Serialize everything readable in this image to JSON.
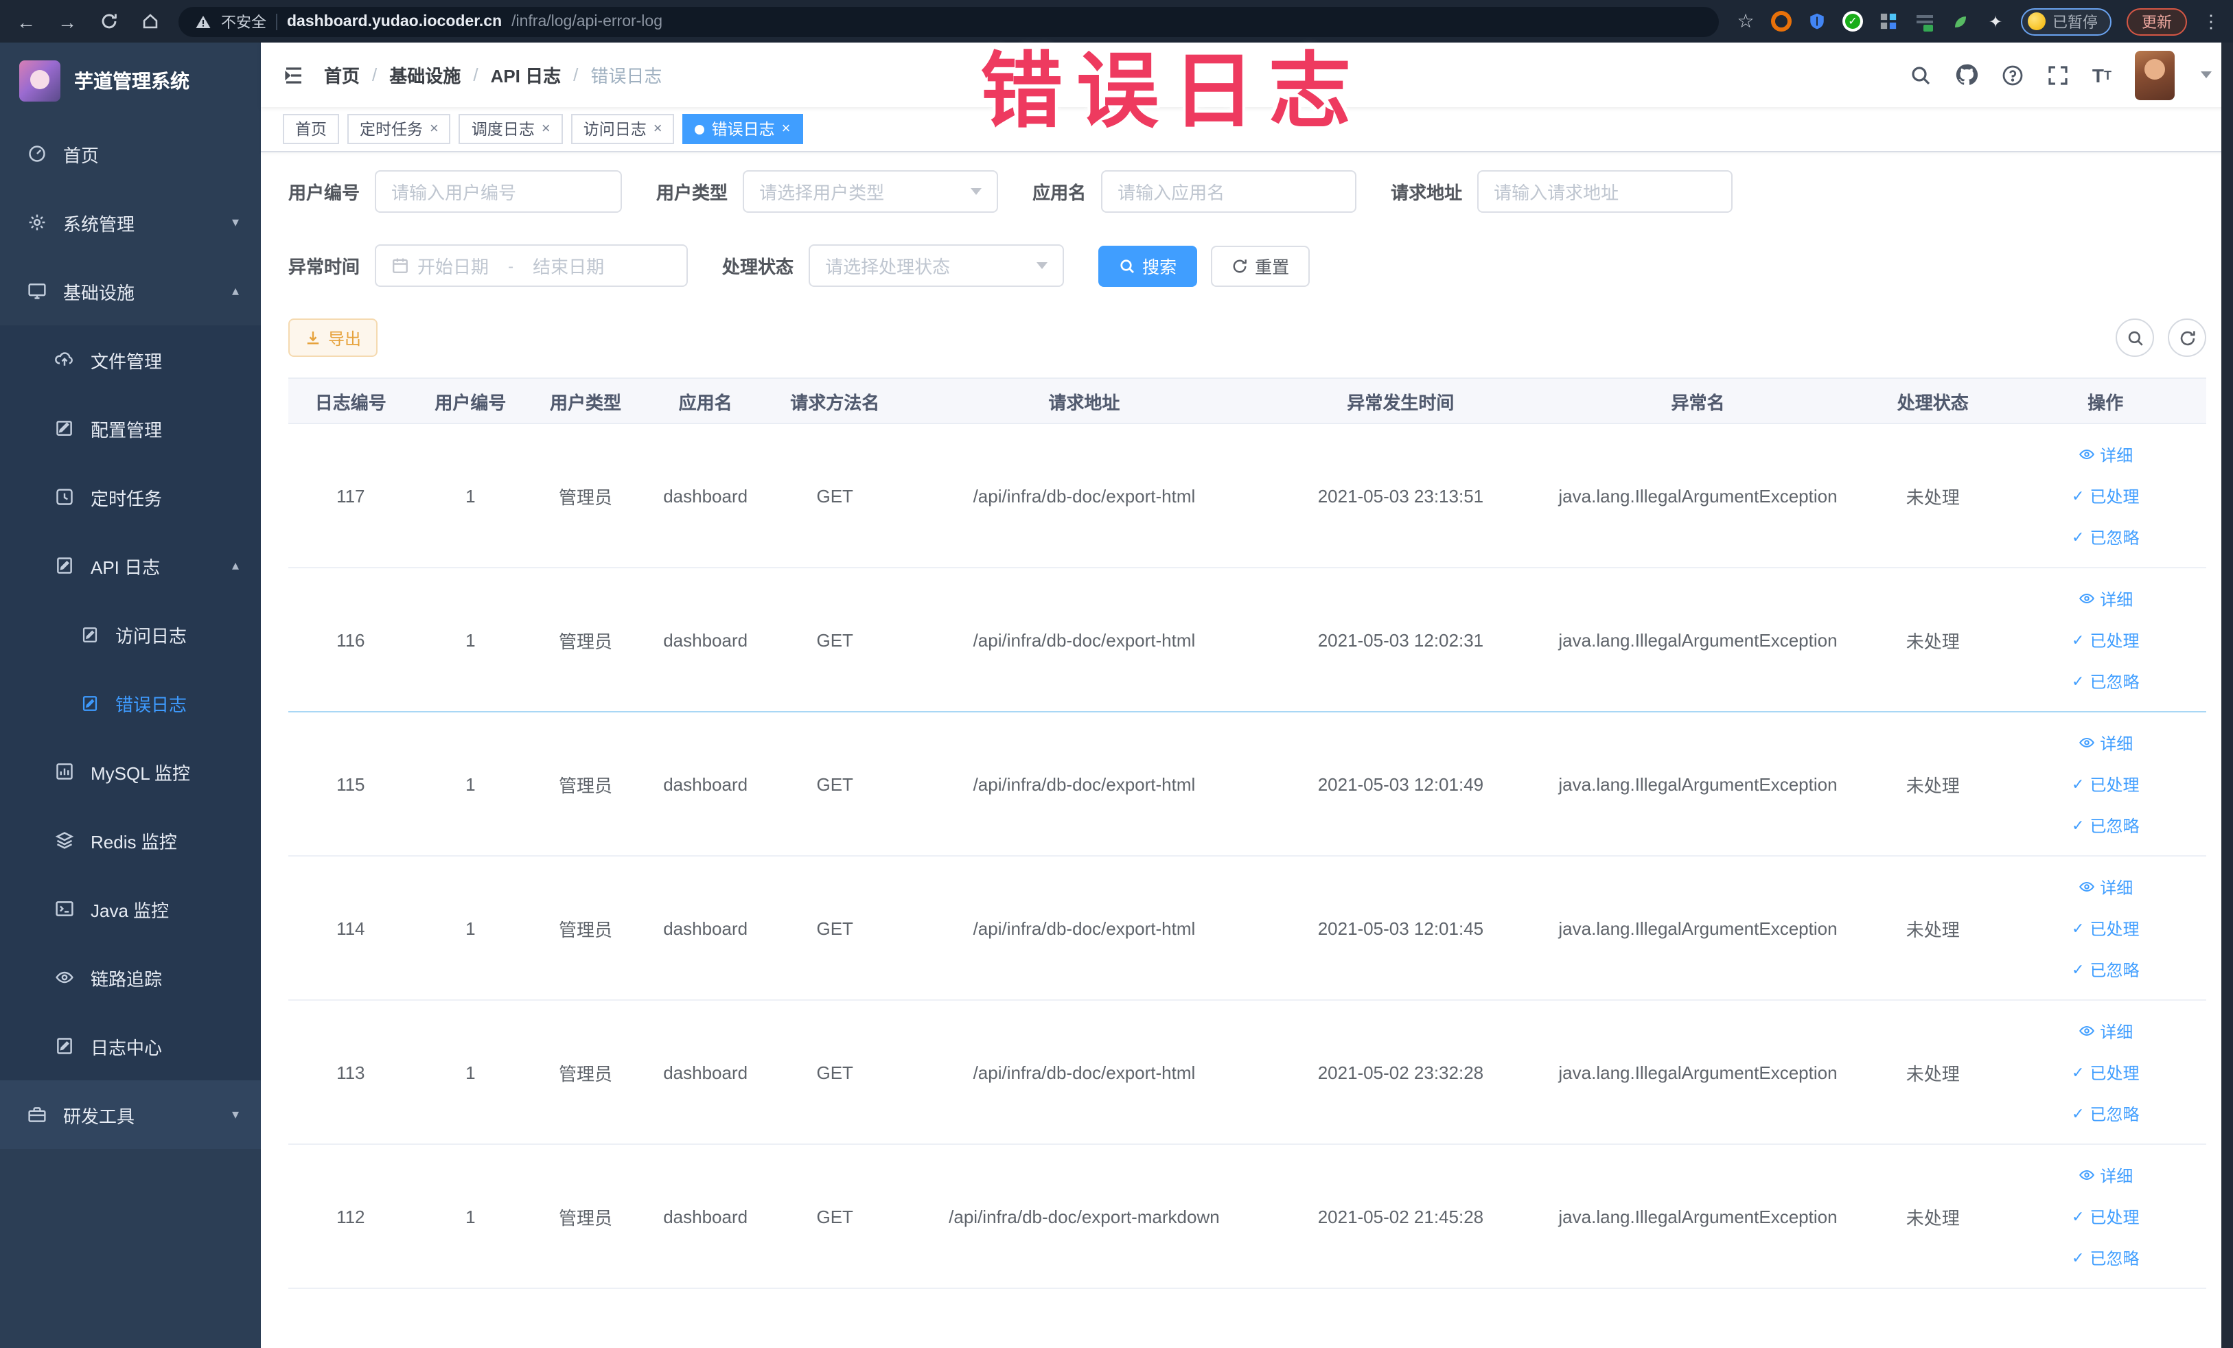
{
  "browser": {
    "security_label": "不安全",
    "url_domain": "dashboard.yudao.iocoder.cn",
    "url_path": "/infra/log/api-error-log",
    "paused_badge": "已暂停",
    "update_label": "更新"
  },
  "annotation_text": "错误日志",
  "sidebar": {
    "title": "芋道管理系统",
    "items": [
      {
        "label": "首页"
      },
      {
        "label": "系统管理"
      },
      {
        "label": "基础设施"
      },
      {
        "label": "文件管理"
      },
      {
        "label": "配置管理"
      },
      {
        "label": "定时任务"
      },
      {
        "label": "API 日志"
      },
      {
        "label": "访问日志"
      },
      {
        "label": "错误日志"
      },
      {
        "label": "MySQL 监控"
      },
      {
        "label": "Redis 监控"
      },
      {
        "label": "Java 监控"
      },
      {
        "label": "链路追踪"
      },
      {
        "label": "日志中心"
      },
      {
        "label": "研发工具"
      }
    ]
  },
  "breadcrumb": {
    "items": [
      "首页",
      "基础设施",
      "API 日志",
      "错误日志"
    ]
  },
  "tags": [
    {
      "label": "首页"
    },
    {
      "label": "定时任务"
    },
    {
      "label": "调度日志"
    },
    {
      "label": "访问日志"
    },
    {
      "label": "错误日志"
    }
  ],
  "filters": {
    "user_id_label": "用户编号",
    "user_id_placeholder": "请输入用户编号",
    "user_type_label": "用户类型",
    "user_type_placeholder": "请选择用户类型",
    "app_name_label": "应用名",
    "app_name_placeholder": "请输入应用名",
    "request_url_label": "请求地址",
    "request_url_placeholder": "请输入请求地址",
    "exception_time_label": "异常时间",
    "date_start_placeholder": "开始日期",
    "date_separator": "-",
    "date_end_placeholder": "结束日期",
    "process_status_label": "处理状态",
    "process_status_placeholder": "请选择处理状态",
    "search_label": "搜索",
    "reset_label": "重置"
  },
  "toolbar": {
    "export_label": "导出"
  },
  "table": {
    "headers": [
      "日志编号",
      "用户编号",
      "用户类型",
      "应用名",
      "请求方法名",
      "请求地址",
      "异常发生时间",
      "异常名",
      "处理状态",
      "操作"
    ],
    "action_labels": {
      "detail": "详细",
      "processed": "已处理",
      "ignored": "已忽略"
    },
    "rows": [
      {
        "cells": [
          "117",
          "1",
          "管理员",
          "dashboard",
          "GET",
          "/api/infra/db-doc/export-html",
          "2021-05-03 23:13:51",
          "java.lang.IllegalArgumentException",
          "未处理"
        ]
      },
      {
        "cells": [
          "116",
          "1",
          "管理员",
          "dashboard",
          "GET",
          "/api/infra/db-doc/export-html",
          "2021-05-03 12:02:31",
          "java.lang.IllegalArgumentException",
          "未处理"
        ]
      },
      {
        "cells": [
          "115",
          "1",
          "管理员",
          "dashboard",
          "GET",
          "/api/infra/db-doc/export-html",
          "2021-05-03 12:01:49",
          "java.lang.IllegalArgumentException",
          "未处理"
        ]
      },
      {
        "cells": [
          "114",
          "1",
          "管理员",
          "dashboard",
          "GET",
          "/api/infra/db-doc/export-html",
          "2021-05-03 12:01:45",
          "java.lang.IllegalArgumentException",
          "未处理"
        ]
      },
      {
        "cells": [
          "113",
          "1",
          "管理员",
          "dashboard",
          "GET",
          "/api/infra/db-doc/export-html",
          "2021-05-02 23:32:28",
          "java.lang.IllegalArgumentException",
          "未处理"
        ]
      },
      {
        "cells": [
          "112",
          "1",
          "管理员",
          "dashboard",
          "GET",
          "/api/infra/db-doc/export-markdown",
          "2021-05-02 21:45:28",
          "java.lang.IllegalArgumentException",
          "未处理"
        ]
      }
    ]
  },
  "colors": {
    "accent": "#409eff",
    "warning": "#e6a23c",
    "annotation_red": "#ee3a5f",
    "sidebar_bg": "#2c3e55"
  }
}
